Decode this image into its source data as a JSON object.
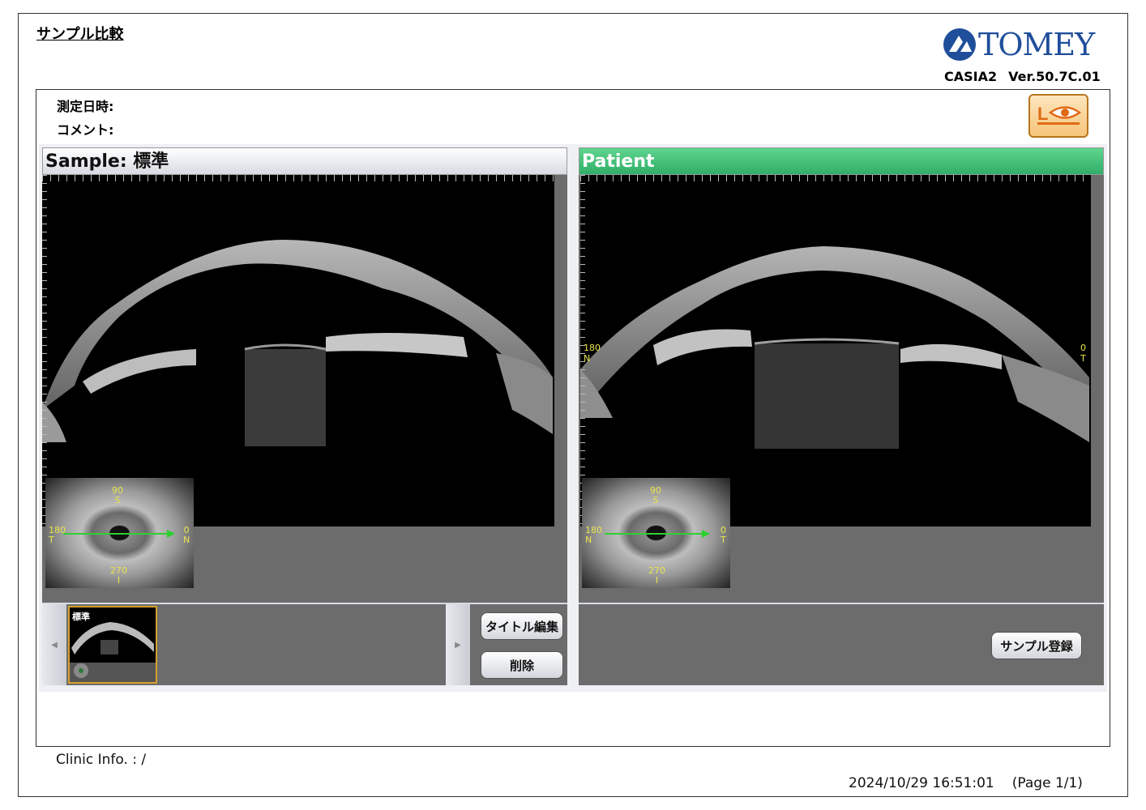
{
  "header": {
    "page_title": "サンプル比較",
    "logo_text": "TOMEY",
    "product": "CASIA2",
    "version": "Ver.50.7C.01"
  },
  "info": {
    "measured_label": "測定日時:",
    "comment_label": "コメント:"
  },
  "eye_indicator": {
    "label": "L",
    "color": "#e06a16"
  },
  "sample_panel": {
    "title": "Sample: 標準",
    "eye_map": {
      "top": [
        "90",
        "S"
      ],
      "left": [
        "180",
        "T"
      ],
      "right": [
        "0",
        "N"
      ],
      "bottom": [
        "270",
        "I"
      ]
    }
  },
  "patient_panel": {
    "title": "Patient",
    "scan_left": [
      "180",
      "N"
    ],
    "scan_right": [
      "0",
      "T"
    ],
    "eye_map": {
      "top": [
        "90",
        "S"
      ],
      "left": [
        "180",
        "N"
      ],
      "right": [
        "0",
        "T"
      ],
      "bottom": [
        "270",
        "I"
      ]
    }
  },
  "thumbnail": {
    "label": "標準"
  },
  "buttons": {
    "scroll_left": "◀",
    "scroll_right": "▶",
    "edit_title": "タイトル編集",
    "delete": "削除",
    "register_sample": "サンプル登録"
  },
  "footer": {
    "clinic_info": "Clinic Info. :    /",
    "datetime": "2024/10/29 16:51:01",
    "page": "(Page 1/1)"
  },
  "colors": {
    "patient_header": "#2fae67",
    "panel_bg": "#6c6c6c",
    "axis_label": "#e8e44c",
    "scan_arrow": "#2dd12d",
    "logo": "#1f4e9a"
  }
}
